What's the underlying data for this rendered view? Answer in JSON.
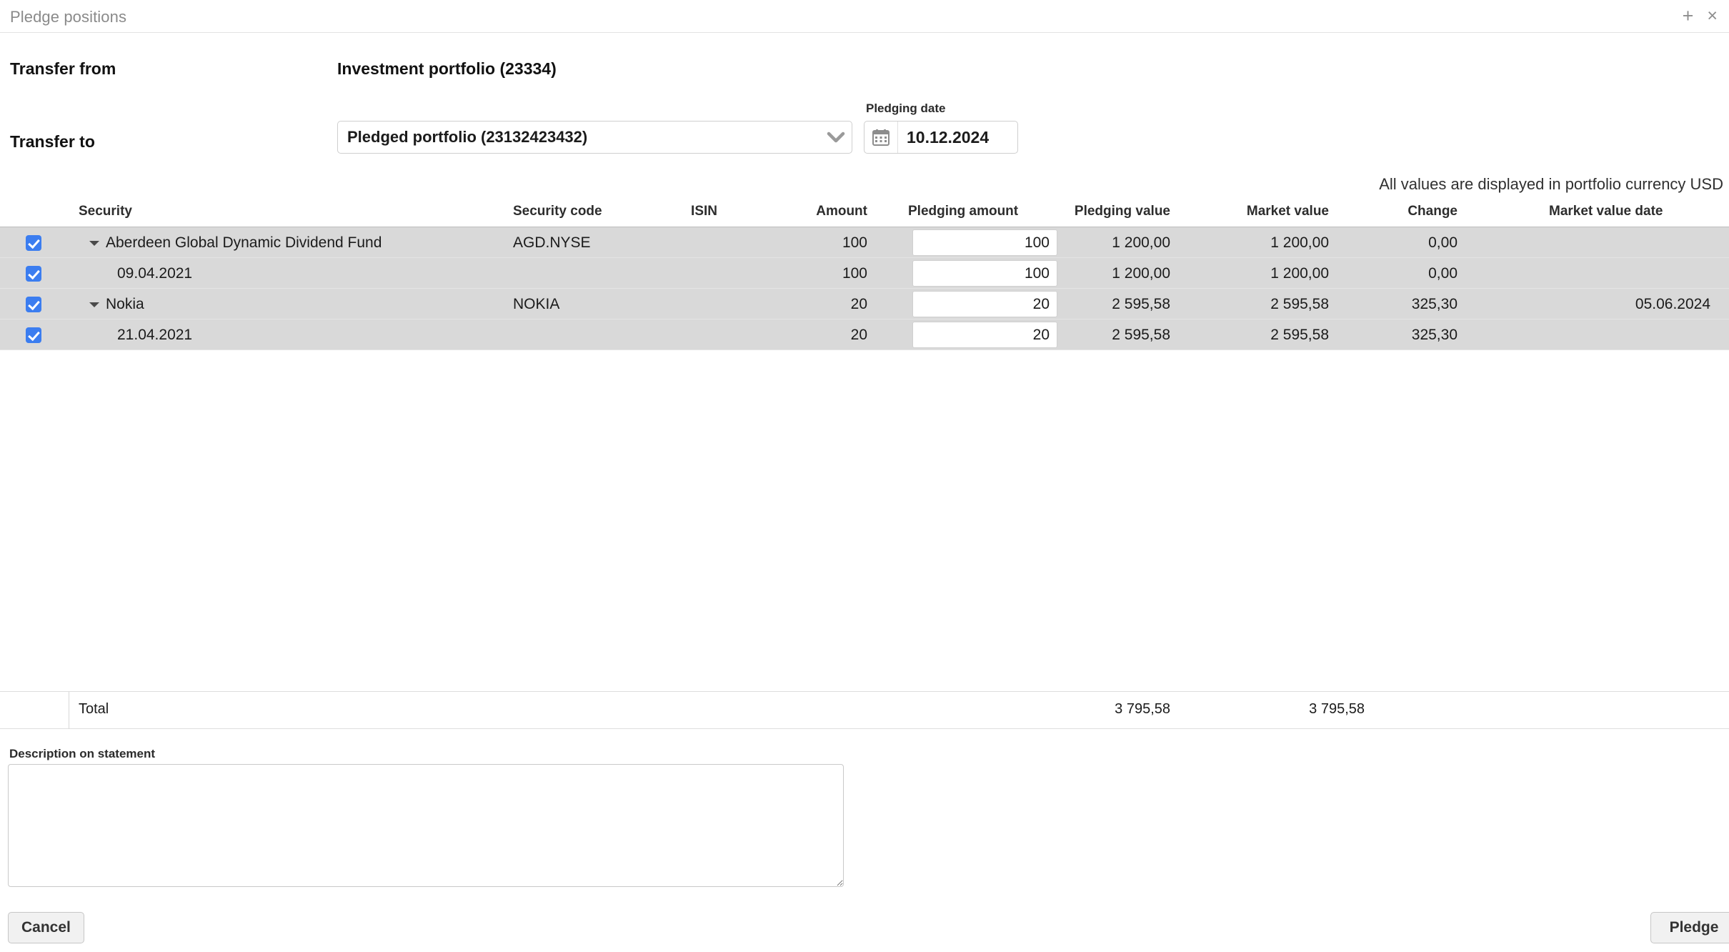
{
  "window": {
    "title": "Pledge positions",
    "add_icon": "plus-icon",
    "close_icon": "close-icon",
    "plus_glyph": "+",
    "close_glyph": "×"
  },
  "form": {
    "transfer_from_label": "Transfer from",
    "transfer_from_value": "Investment portfolio (23334)",
    "transfer_to_label": "Transfer to",
    "transfer_to_value": "Pledged portfolio (23132423432)",
    "pledging_date_label": "Pledging date",
    "pledging_date_value": "10.12.2024",
    "calendar_icon": "calendar-icon",
    "chevron_icon": "chevron-down-icon"
  },
  "table": {
    "currency_note": "All values are displayed in portfolio currency USD",
    "columns": [
      "Security",
      "Security code",
      "ISIN",
      "Amount",
      "Pledging amount",
      "Pledging value",
      "Market value",
      "Change",
      "Market value date"
    ],
    "header_checkbox_checked": true,
    "rows": [
      {
        "checked": true,
        "expandable": true,
        "expanded": true,
        "indent": 0,
        "security": "Aberdeen Global Dynamic Dividend Fund",
        "security_code": "AGD.NYSE",
        "isin": "",
        "amount": "100",
        "pledging_amount": "100",
        "pledging_value": "1 200,00",
        "market_value": "1 200,00",
        "change": "0,00",
        "market_value_date": ""
      },
      {
        "checked": true,
        "expandable": false,
        "expanded": false,
        "indent": 1,
        "security": "09.04.2021",
        "security_code": "",
        "isin": "",
        "amount": "100",
        "pledging_amount": "100",
        "pledging_value": "1 200,00",
        "market_value": "1 200,00",
        "change": "0,00",
        "market_value_date": ""
      },
      {
        "checked": true,
        "expandable": true,
        "expanded": true,
        "indent": 0,
        "security": "Nokia",
        "security_code": "NOKIA",
        "isin": "",
        "amount": "20",
        "pledging_amount": "20",
        "pledging_value": "2 595,58",
        "market_value": "2 595,58",
        "change": "325,30",
        "market_value_date": "05.06.2024"
      },
      {
        "checked": true,
        "expandable": false,
        "expanded": false,
        "indent": 1,
        "security": "21.04.2021",
        "security_code": "",
        "isin": "",
        "amount": "20",
        "pledging_amount": "20",
        "pledging_value": "2 595,58",
        "market_value": "2 595,58",
        "change": "325,30",
        "market_value_date": ""
      }
    ],
    "total": {
      "label": "Total",
      "pledging_value": "3 795,58",
      "market_value": "3 795,58"
    }
  },
  "description": {
    "label": "Description on statement",
    "value": "",
    "placeholder": ""
  },
  "footer": {
    "cancel_label": "Cancel",
    "pledge_label": "Pledge"
  },
  "colors": {
    "accent": "#3b7df0",
    "row_bg": "#d9d9d9",
    "title_text": "#8a8a8a"
  }
}
